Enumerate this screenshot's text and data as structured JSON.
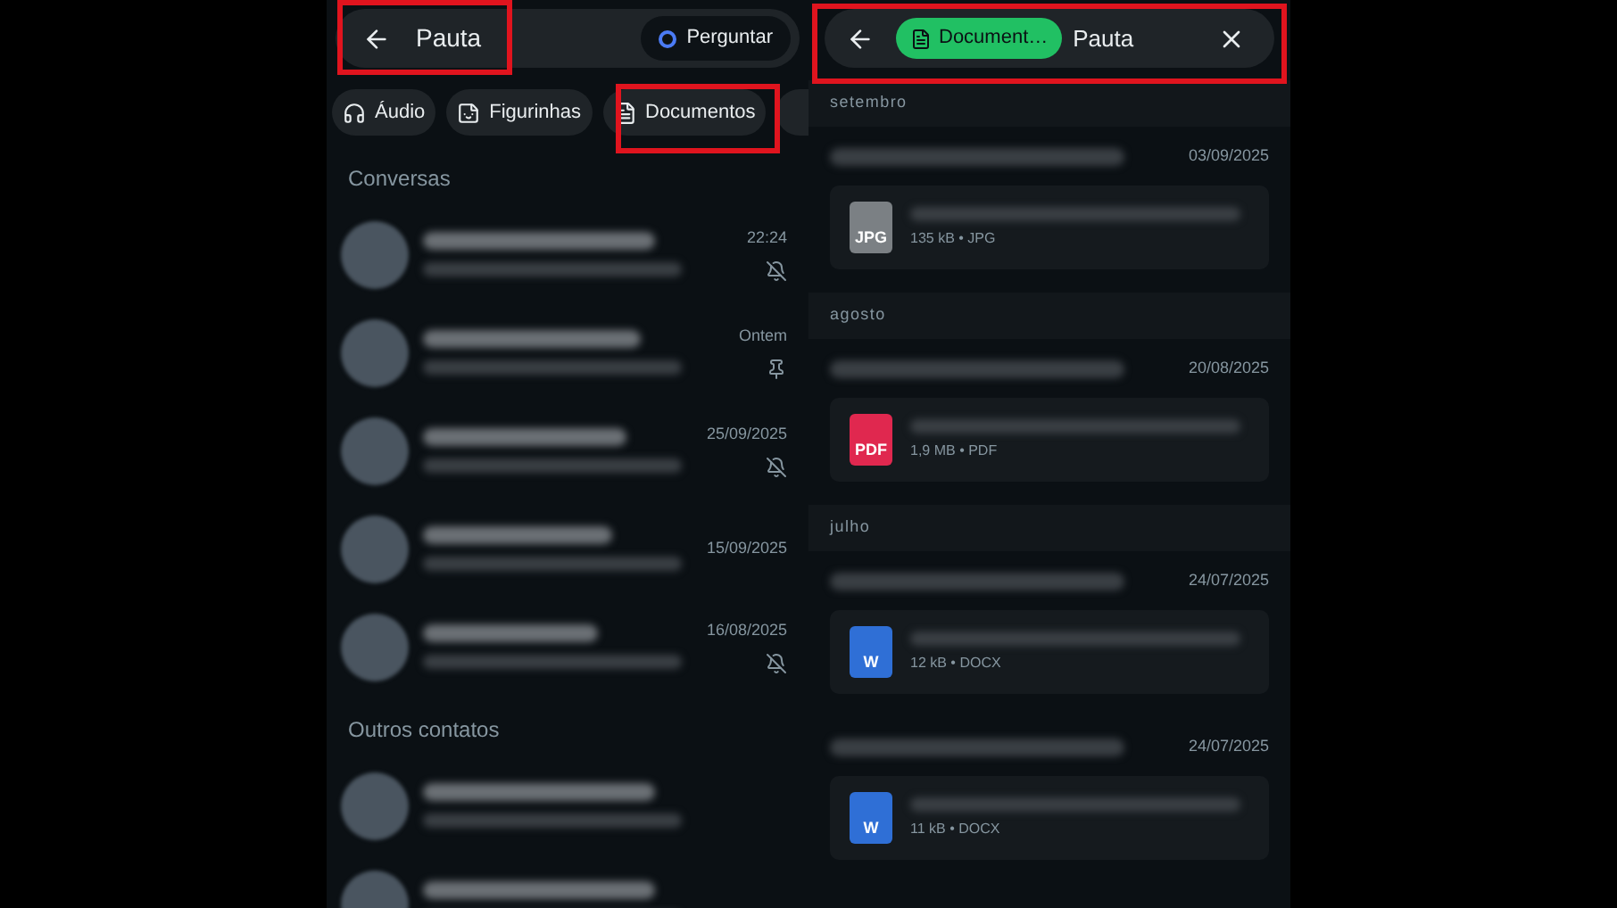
{
  "left": {
    "search": {
      "value": "Pauta",
      "ask_button": "Perguntar"
    },
    "filters": [
      {
        "label": "Áudio",
        "kind": "audio",
        "selected": false
      },
      {
        "label": "Figurinhas",
        "kind": "sticker",
        "selected": false
      },
      {
        "label": "Documentos",
        "kind": "document",
        "selected": false
      }
    ],
    "sections": [
      {
        "title": "Conversas",
        "items": [
          {
            "time": "22:24",
            "muted": true,
            "pinned": false
          },
          {
            "time": "Ontem",
            "muted": false,
            "pinned": true
          },
          {
            "time": "25/09/2025",
            "muted": true,
            "pinned": false
          },
          {
            "time": "15/09/2025",
            "muted": false,
            "pinned": false
          },
          {
            "time": "16/08/2025",
            "muted": true,
            "pinned": false
          }
        ]
      },
      {
        "title": "Outros contatos",
        "items": [
          {
            "muted": false,
            "pinned": false
          },
          {
            "muted": false,
            "pinned": false
          }
        ]
      }
    ]
  },
  "right": {
    "search": {
      "chip": "Document…",
      "value": "Pauta"
    },
    "groups": [
      {
        "month": "setembro",
        "messages": [
          {
            "date": "03/09/2025",
            "file": {
              "kind": "jpg",
              "icon_label": "JPG",
              "meta": "135 kB • JPG"
            }
          }
        ]
      },
      {
        "month": "agosto",
        "messages": [
          {
            "date": "20/08/2025",
            "file": {
              "kind": "pdf",
              "icon_label": "PDF",
              "meta": "1,9 MB • PDF"
            }
          }
        ]
      },
      {
        "month": "julho",
        "messages": [
          {
            "date": "24/07/2025",
            "file": {
              "kind": "docx",
              "icon_label": "W",
              "meta": "12 kB • DOCX"
            }
          },
          {
            "date": "24/07/2025",
            "file": {
              "kind": "docx",
              "icon_label": "W",
              "meta": "11 kB • DOCX"
            }
          }
        ]
      }
    ]
  }
}
